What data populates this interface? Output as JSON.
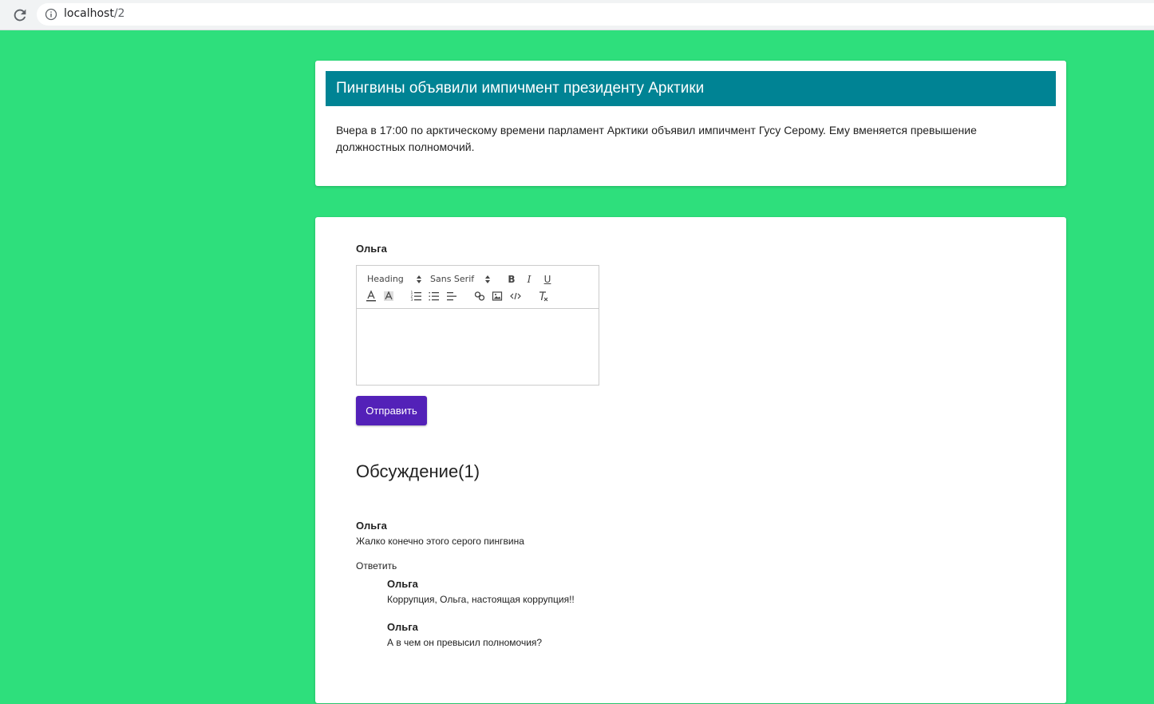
{
  "browser": {
    "url_host": "localhost",
    "url_path": "/2"
  },
  "news": {
    "title": "Пингвины объявили импичмент президенту Арктики",
    "body": "Вчера в 17:00 по арктическому времени парламент Арктики объявил импичмент Гусу Серому. Ему вменяется превышение должностных полномочий."
  },
  "comment_form": {
    "author": "Ольга",
    "header_select": "Heading",
    "font_select": "Sans Serif",
    "submit_label": "Отправить"
  },
  "discussion": {
    "title": "Обсуждение(1)",
    "comments": [
      {
        "author": "Ольга",
        "text": "Жалко конечно этого серого пингвина",
        "reply_label": "Ответить",
        "replies": [
          {
            "author": "Ольга",
            "text": "Коррупция, Ольга, настоящая коррупция!!"
          },
          {
            "author": "Ольга",
            "text": "А в чем он превысил полномочия?"
          }
        ]
      }
    ]
  },
  "colors": {
    "background": "#2edf7c",
    "header": "#008394",
    "button": "#5321b8"
  }
}
